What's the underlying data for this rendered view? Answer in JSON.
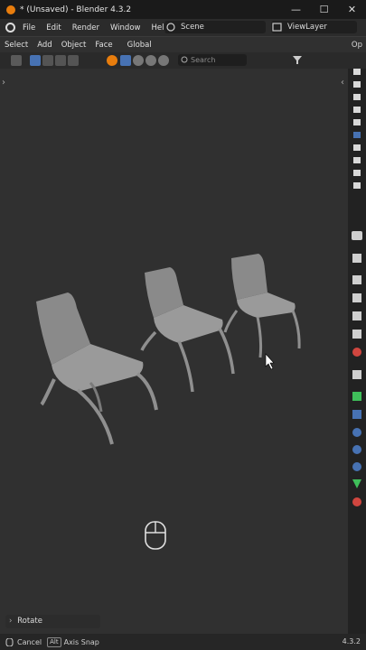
{
  "window": {
    "title": "* (Unsaved) - Blender 4.3.2",
    "minimize": "—",
    "maximize": "☐",
    "close": "✕"
  },
  "menu": {
    "items": [
      "File",
      "Edit",
      "Render",
      "Window",
      "Help"
    ]
  },
  "scene": {
    "label": "Scene"
  },
  "view_layer": {
    "label": "ViewLayer"
  },
  "header": {
    "items": [
      "Select",
      "Add",
      "Object",
      "Face"
    ],
    "orientation": "Global",
    "overflow_label": "Op"
  },
  "search": {
    "placeholder": "Search"
  },
  "status": {
    "cancel_label": "Cancel",
    "alt_key": "Alt",
    "axis_snap_label": "Axis Snap",
    "version": "4.3.2"
  },
  "operator_panel": {
    "label": "Rotate"
  },
  "colors": {
    "accent_blue": "#4772b3",
    "orange": "#e87d0d",
    "green": "#3fbf5a",
    "red": "#d0463f",
    "viewport_bg": "#303030"
  },
  "icons": [
    "blender-logo",
    "scene-icon",
    "view-layer-icon",
    "select-box-icon",
    "search-icon",
    "filter-icon",
    "camera-icon",
    "wrench-icon",
    "mouse-icon"
  ]
}
